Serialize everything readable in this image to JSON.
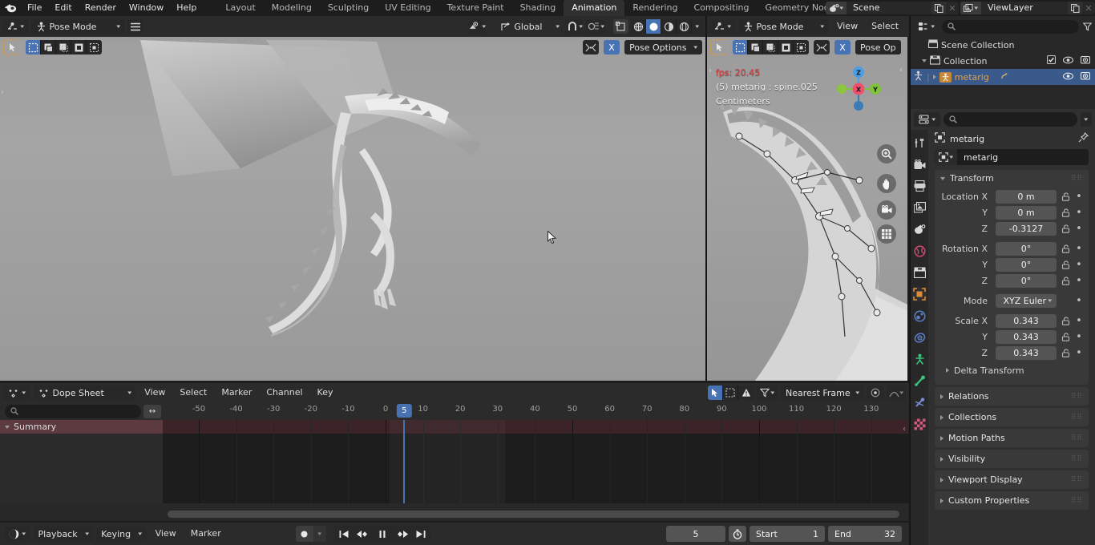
{
  "topbar": {
    "logo_icon": "blender-logo",
    "menus": [
      "File",
      "Edit",
      "Render",
      "Window",
      "Help"
    ],
    "workspaces": [
      "Layout",
      "Modeling",
      "Sculpting",
      "UV Editing",
      "Texture Paint",
      "Shading",
      "Animation",
      "Rendering",
      "Compositing",
      "Geometry Nod"
    ],
    "active_workspace": "Animation",
    "scene": {
      "icon": "scene-icon",
      "name": "Scene",
      "new_icon": "copy-icon",
      "unlink_icon": "x-icon"
    },
    "viewlayer": {
      "icon": "viewlayer-icon",
      "name": "ViewLayer",
      "new_icon": "copy-icon",
      "unlink_icon": "x-icon"
    }
  },
  "viewport_main": {
    "editor_icon": "editor-type-icon",
    "mode": "Pose Mode",
    "menu_icon": "hamburger-icon",
    "orientation": "Global",
    "snap_icon": "magnet-icon",
    "proportional_icon": "proportional-edit-icon",
    "shading_modes": [
      "wireframe",
      "solid",
      "material-preview",
      "rendered"
    ],
    "active_shading": "solid",
    "visibility_icon": "show-overlays-icon",
    "xray_icon": "xray-icon",
    "gizmo_icon": "gizmo-icon",
    "tool_icon": "tweak-tool-icon",
    "select_modes": [
      "set",
      "extend",
      "subtract",
      "invert",
      "intersect"
    ],
    "active_select_mode": "set"
  },
  "viewport_side": {
    "editor_icon": "editor-type-icon",
    "mode": "Pose Mode",
    "menus": [
      "View",
      "Select"
    ],
    "pose_options": "Pose Op",
    "xmirror_icon": "x-mirror-icon",
    "xmirror_label": "X",
    "overlay": {
      "fps": "fps: 20.45",
      "fps_color": "#e04040",
      "object_info": "(5) metarig : spine.025",
      "units": "Centimeters"
    },
    "gizmo_axes": [
      "Z",
      "X",
      "Y"
    ],
    "nav_buttons": [
      "zoom-icon",
      "pan-icon",
      "camera-icon",
      "grid-icon"
    ]
  },
  "viewport_main_header2": {
    "pose_options": "Pose Options",
    "xmirror_label": "X"
  },
  "outliner": {
    "display_mode_icon": "outliner-display-icon",
    "filter_icon": "filter-icon",
    "search_placeholder": "",
    "rows": [
      {
        "label": "Scene Collection",
        "icon": "collection-icon",
        "indent": 0,
        "selected": false,
        "has_arrow": false,
        "checkbox": false,
        "eye": false,
        "camera": false
      },
      {
        "label": "Collection",
        "icon": "collection-icon",
        "indent": 1,
        "selected": false,
        "has_arrow": true,
        "arrow_open": true,
        "checkbox": true,
        "eye": true,
        "camera": true
      },
      {
        "label": "metarig",
        "icon": "armature-icon",
        "indent": 2,
        "selected": true,
        "has_arrow": true,
        "arrow_open": false,
        "checkbox": false,
        "eye": true,
        "camera": true,
        "extra_icon": "pose-icon"
      }
    ]
  },
  "properties": {
    "editor_icon": "properties-editor-icon",
    "search_placeholder": "",
    "tabs": [
      "tool-icon",
      "render-icon",
      "output-icon",
      "viewlayer-icon",
      "scene-icon",
      "world-icon",
      "collection-icon",
      "object-icon",
      "modifier-icon",
      "physics-icon",
      "constraint-icon",
      "armature-data-icon",
      "bone-icon",
      "bone-constraint-icon",
      "texture-icon"
    ],
    "active_tab": "object-icon",
    "breadcrumb": {
      "icon": "object-icon",
      "name": "metarig",
      "pin_icon": "pin-icon"
    },
    "id_name": "metarig",
    "panels": [
      {
        "title": "Transform",
        "open": true,
        "rows": [
          {
            "label": "Location X",
            "value": "0 m",
            "lock": true,
            "dot": true
          },
          {
            "label": "Y",
            "value": "0 m",
            "lock": true,
            "dot": true
          },
          {
            "label": "Z",
            "value": "-0.3127",
            "lock": true,
            "dot": true
          },
          {
            "label": "Rotation X",
            "value": "0°",
            "lock": true,
            "dot": true
          },
          {
            "label": "Y",
            "value": "0°",
            "lock": true,
            "dot": true
          },
          {
            "label": "Z",
            "value": "0°",
            "lock": true,
            "dot": true
          },
          {
            "label": "Mode",
            "value": "XYZ Euler",
            "dropdown": true,
            "lock": false,
            "dot": true
          },
          {
            "label": "Scale X",
            "value": "0.343",
            "lock": true,
            "dot": true
          },
          {
            "label": "Y",
            "value": "0.343",
            "lock": true,
            "dot": true
          },
          {
            "label": "Z",
            "value": "0.343",
            "lock": true,
            "dot": true
          }
        ],
        "sub_panel": "Delta Transform"
      }
    ],
    "collapsed_panels": [
      "Relations",
      "Collections",
      "Motion Paths",
      "Visibility",
      "Viewport Display",
      "Custom Properties"
    ]
  },
  "dopesheet": {
    "editor_icon": "dopesheet-editor-icon",
    "mode": "Dope Sheet",
    "menus": [
      "View",
      "Select",
      "Marker",
      "Channel",
      "Key"
    ],
    "search_placeholder": "",
    "filter_toggles": [
      "only-selected-icon",
      "show-hidden-icon",
      "show-errors-icon"
    ],
    "filter_icon": "filter-icon",
    "snap_mode": "Nearest Frame",
    "proportional_icon": "proportional-edit-icon",
    "falloff_icon": "falloff-icon",
    "channels": [
      {
        "label": "Summary",
        "expanded": true
      }
    ],
    "ruler_ticks": [
      -50,
      -40,
      -30,
      -20,
      -10,
      0,
      10,
      20,
      30,
      40,
      50,
      60,
      70,
      80,
      90,
      100,
      110,
      120,
      130
    ],
    "current_frame": 5
  },
  "timeline": {
    "editor_icon": "timeline-editor-icon",
    "menus_drop": [
      "Playback",
      "Keying"
    ],
    "menus": [
      "View",
      "Marker"
    ],
    "record_icon": "record-icon",
    "transport": [
      "jump-start-icon",
      "prev-keyframe-icon",
      "play-pause-icon",
      "next-keyframe-icon",
      "jump-end-icon"
    ],
    "current_frame": "5",
    "timer_icon": "auto-key-icon",
    "start_label": "Start",
    "start_value": "1",
    "end_label": "End",
    "end_value": "32"
  },
  "colors": {
    "accent_blue": "#4772b3",
    "orange": "#e09a36",
    "summary_red": "#5d3a3f",
    "fps_red": "#e04040",
    "bg_dark": "#1d1d1d",
    "panel_gray": "#393939"
  }
}
